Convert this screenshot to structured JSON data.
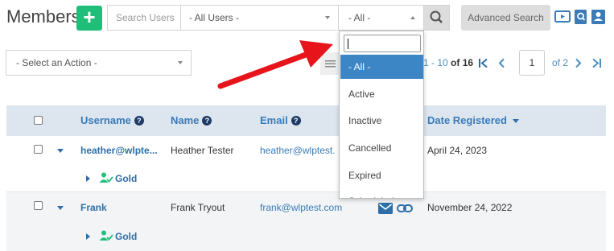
{
  "header": {
    "title": "Members",
    "add_icon": "plus-icon",
    "search_placeholder": "Search Users",
    "users_filter": "- All Users -",
    "status_filter": "- All -",
    "advanced_search": "Advanced Search",
    "icons": [
      "video-icon",
      "search-doc-icon",
      "user-card-icon"
    ]
  },
  "actions": {
    "select": "- Select an Action -"
  },
  "pagination": {
    "range": "1 - 10",
    "of": "of",
    "total": "16",
    "page": "1",
    "of_pages": "of 2"
  },
  "table": {
    "headers": {
      "username": "Username",
      "name": "Name",
      "email": "Email",
      "date": "Date Registered"
    },
    "rows": [
      {
        "username": "heather@wlpte...",
        "name": "Heather Tester",
        "email": "heather@wlptest.",
        "date": "April 24, 2023",
        "level": "Gold"
      },
      {
        "username": "Frank",
        "name": "Frank Tryout",
        "email": "frank@wlptest.com",
        "date": "November 24, 2022",
        "level": "Gold"
      }
    ]
  },
  "dropdown": {
    "options": [
      "- All -",
      "Active",
      "Inactive",
      "Cancelled",
      "Expired",
      "Scheduled"
    ],
    "selected": "- All -"
  },
  "colors": {
    "accent": "#3a7bb8",
    "add_button": "#1fbf7a",
    "selected_option": "#3d86c6",
    "arrow": "#e8141c"
  }
}
